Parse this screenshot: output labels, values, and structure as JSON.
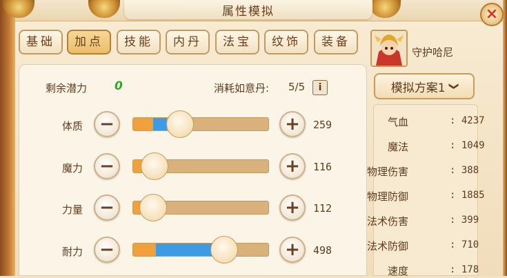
{
  "title": "属性模拟",
  "close_icon": "×",
  "tabs": [
    {
      "label": "基础",
      "active": false
    },
    {
      "label": "加点",
      "active": true
    },
    {
      "label": "技能",
      "active": false
    },
    {
      "label": "内丹",
      "active": false
    },
    {
      "label": "法宝",
      "active": false
    },
    {
      "label": "纹饰",
      "active": false
    },
    {
      "label": "装备",
      "active": false
    }
  ],
  "potential": {
    "label": "剩余潜力",
    "value": "0"
  },
  "ruyi": {
    "label": "消耗如意丹:",
    "value": "5/5",
    "info_icon": "i"
  },
  "attributes": [
    {
      "label": "体质",
      "value": "259",
      "orange_fraction": 0.15,
      "blue_fraction": 0.1,
      "knob_fraction": 0.35,
      "minus": "−",
      "plus": "+"
    },
    {
      "label": "魔力",
      "value": "116",
      "orange_fraction": 0.07,
      "blue_fraction": 0.0,
      "knob_fraction": 0.16,
      "minus": "−",
      "plus": "+"
    },
    {
      "label": "力量",
      "value": "112",
      "orange_fraction": 0.07,
      "blue_fraction": 0.0,
      "knob_fraction": 0.15,
      "minus": "−",
      "plus": "+"
    },
    {
      "label": "耐力",
      "value": "498",
      "orange_fraction": 0.17,
      "blue_fraction": 0.43,
      "knob_fraction": 0.67,
      "minus": "−",
      "plus": "+"
    }
  ],
  "character": {
    "name": "守护哈尼"
  },
  "scheme": {
    "label": "模拟方案1",
    "chevron": "❯"
  },
  "stats": [
    {
      "label": "气血",
      "value": ": 4237"
    },
    {
      "label": "魔法",
      "value": ": 1049"
    },
    {
      "label": "物理伤害",
      "value": ": 388"
    },
    {
      "label": "物理防御",
      "value": ": 1885"
    },
    {
      "label": "法术伤害",
      "value": ": 399"
    },
    {
      "label": "法术防御",
      "value": ": 710"
    },
    {
      "label": "速度",
      "value": ": 178"
    }
  ],
  "colors": {
    "accent": "#f0a13a",
    "bar_blue": "#3d9be3",
    "zero_green": "#2fa52c",
    "close_red": "#d8301f"
  }
}
